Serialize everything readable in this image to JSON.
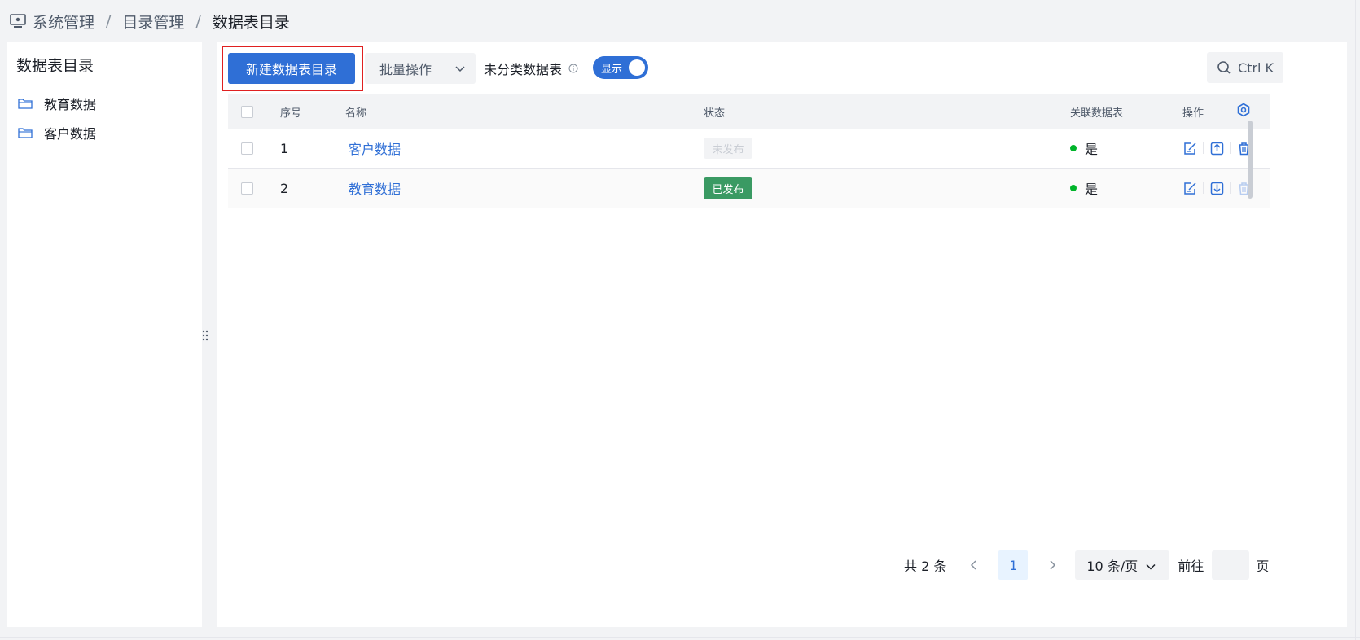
{
  "breadcrumb": {
    "items": [
      "系统管理",
      "目录管理",
      "数据表目录"
    ],
    "separator": "/"
  },
  "sidebar": {
    "title": "数据表目录",
    "items": [
      {
        "label": "教育数据",
        "icon": "folder-icon"
      },
      {
        "label": "客户数据",
        "icon": "folder-icon"
      }
    ]
  },
  "toolbar": {
    "new_label": "新建数据表目录",
    "batch_label": "批量操作",
    "uncat_label": "未分类数据表",
    "toggle_label": "显示",
    "toggle_on": true,
    "search_placeholder": "Ctrl K"
  },
  "table": {
    "headers": {
      "no": "序号",
      "name": "名称",
      "status": "状态",
      "related": "关联数据表",
      "ops": "操作"
    },
    "rows": [
      {
        "no": "1",
        "name": "客户数据",
        "status": "未发布",
        "related": "是"
      },
      {
        "no": "2",
        "name": "教育数据",
        "status": "已发布",
        "related": "是"
      }
    ]
  },
  "pagination": {
    "total": "共 2 条",
    "current": "1",
    "page_size": "10 条/页",
    "goto": "前往",
    "page_unit": "页"
  },
  "colors": {
    "primary": "#2f6fd6",
    "published": "#3a9a63",
    "highlight": "#e02020",
    "dot_green": "#00b42a"
  }
}
